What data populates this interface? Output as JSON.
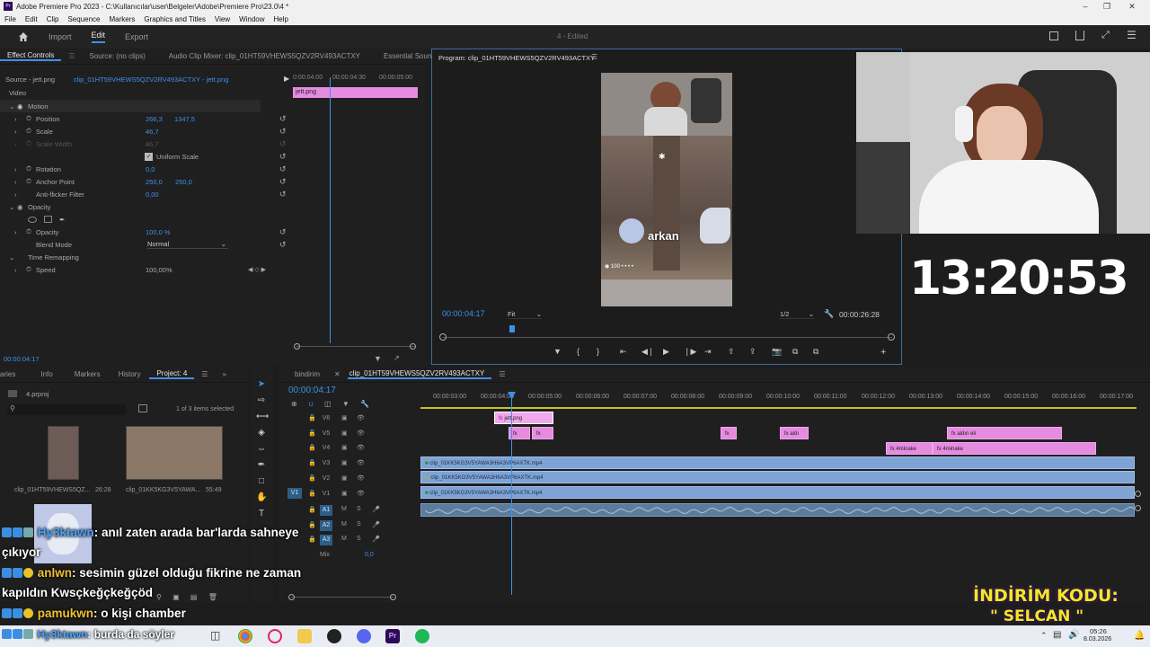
{
  "window": {
    "title": "Adobe Premiere Pro 2023 - C:\\Kullanıcılar\\user\\Belgeler\\Adobe\\Premiere Pro\\23.0\\4 *",
    "menu": [
      "File",
      "Edit",
      "Clip",
      "Sequence",
      "Markers",
      "Graphics and Titles",
      "View",
      "Window",
      "Help"
    ]
  },
  "header": {
    "workspaces": [
      "Import",
      "Edit",
      "Export"
    ],
    "active_workspace": "Edit",
    "project_status": "4 - Edited"
  },
  "effect_controls": {
    "tabs": [
      "Effect Controls",
      "Source: (no clips)",
      "Audio Clip Mixer: clip_01HT59VHEWS5QZV2RV493ACTXY",
      "Essential Sound"
    ],
    "source_label": "Source - jett.png",
    "sequence_label": "clip_01HT59VHEWS5QZV2RV493ACTXY - jett.png",
    "section_video": "Video",
    "motion": "Motion",
    "position_label": "Position",
    "position_x": "266,3",
    "position_y": "1347,5",
    "scale_label": "Scale",
    "scale_value": "46,7",
    "scale_width_label": "Scale Width",
    "scale_width_value": "46,7",
    "uniform_scale": "Uniform Scale",
    "rotation_label": "Rotation",
    "rotation_value": "0,0",
    "anchor_label": "Anchor Point",
    "anchor_x": "250,0",
    "anchor_y": "250,0",
    "antiflicker_label": "Anti-flicker Filter",
    "antiflicker_value": "0,00",
    "opacity_section": "Opacity",
    "opacity_label": "Opacity",
    "opacity_value": "100,0 %",
    "blend_label": "Blend Mode",
    "blend_value": "Normal",
    "time_remap": "Time Remapping",
    "speed_label": "Speed",
    "speed_value": "100,00%",
    "ruler_times": [
      "0:00:04:00",
      "00:00:04:30",
      "00:00:05:00"
    ],
    "clip_name": "jett.png",
    "timecode": "00:00:04:17"
  },
  "program": {
    "title": "Program: clip_01HT59VHEWS5QZV2RV493ACTXY",
    "timecode": "00:00:04:17",
    "fit": "Fit",
    "resolution": "1/2",
    "duration": "00:00:26:28",
    "caption_text": "arkan"
  },
  "clock": "13:20:53",
  "project": {
    "tabs": [
      "aries",
      "Info",
      "Markers",
      "History",
      "Project: 4"
    ],
    "file": "4.prproj",
    "selection": "1 of 3 items selected",
    "items": [
      {
        "name": "clip_01HT59VHEWS5QZ...",
        "duration": "26:28"
      },
      {
        "name": "clip_01KK5KG3V5YAWA...",
        "duration": "55:49"
      }
    ]
  },
  "timeline": {
    "tabs": [
      "bindirim",
      "clip_01HT59VHEWS5QZV2RV493ACTXY"
    ],
    "timecode": "00:00:04:17",
    "ruler": [
      "00:00:03:00",
      "00:00:04:00",
      "00:00:05:00",
      "00:00:06:00",
      "00:00:07:00",
      "00:00:08:00",
      "00:00:09:00",
      "00:00:10:00",
      "00:00:11:00",
      "00:00:12:00",
      "00:00:13:00",
      "00:00:14:00",
      "00:00:15:00",
      "00:00:16:00",
      "00:00:17:00"
    ],
    "video_tracks": [
      "V6",
      "V5",
      "V4",
      "V3",
      "V2",
      "V1"
    ],
    "audio_tracks": [
      "A1",
      "A2",
      "A3"
    ],
    "mix_label": "Mix",
    "mix_value": "0,0",
    "clips": {
      "jett": "jett.png",
      "fx": "fx",
      "aldi": "aldı",
      "aldin_eli": "aldın eli",
      "minake1": "4minake",
      "minake2": "4minake",
      "v3": "clip_01KK5KG3V5YAWA3H6A3VP6AXTK.mp4",
      "v2": "clip_01KK5KG3V5YAWA3H6A3VP6AXTK.mp4",
      "v1": "clip_01KK5KG3V5YAWA3H6A3VP6AXTK.mp4"
    }
  },
  "chat": [
    {
      "user": "Hy3ktawn",
      "text": ": anıl zaten arada bar'larda sahneye",
      "cont": "çıkıyor"
    },
    {
      "user": "anlwn",
      "text": ": sesimin güzel olduğu fikrine ne zaman",
      "cont": "kapıldın Kwsçkeğçkeğçöd"
    },
    {
      "user": "pamukwn",
      "text": ": o kişi chamber"
    },
    {
      "user": "Hy3ktawn",
      "text": ": burda da söyler"
    }
  ],
  "promo": {
    "line1": "İNDİRİM KODU:",
    "line2": "\" SELCAN \""
  },
  "taskbar": {
    "time": "05:26",
    "date": "8.03.2026"
  },
  "colors": {
    "accent": "#3c92ea",
    "pink_clip": "#e58be0",
    "blue_clip": "#7ea4d6",
    "promo": "#f5e62a"
  }
}
